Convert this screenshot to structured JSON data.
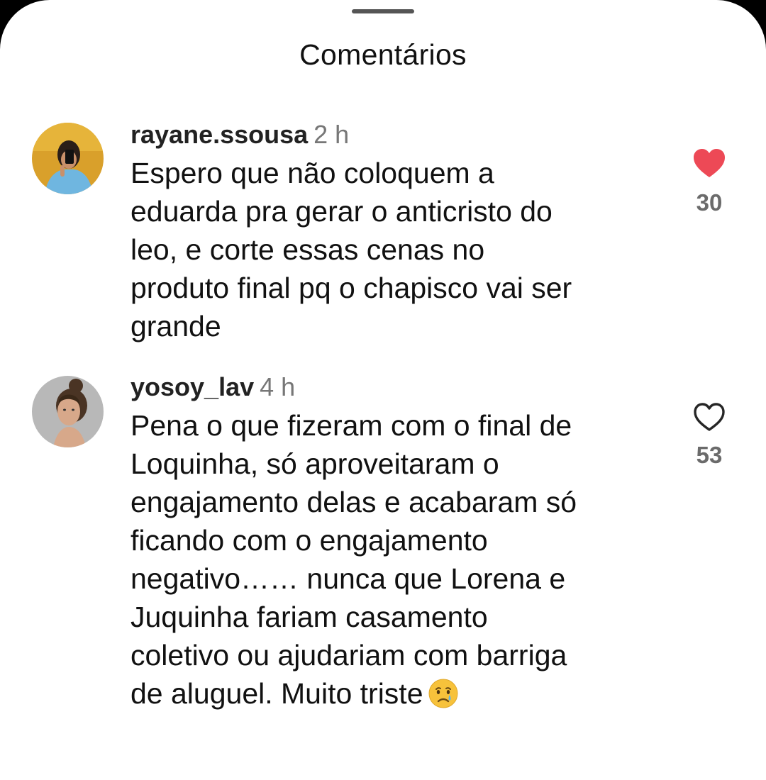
{
  "sheet": {
    "title": "Comentários"
  },
  "comments": [
    {
      "username": "rayane.ssousa",
      "time": "2 h",
      "lines": [
        "Espero que não coloquem a",
        "eduarda pra gerar o anticristo do",
        "leo, e corte essas cenas no",
        "produto final pq o chapisco vai ser",
        "grande"
      ],
      "likes": "30",
      "liked": true,
      "avatar_icon": "avatar-photo"
    },
    {
      "username": "yosoy_lav",
      "time": "4 h",
      "lines": [
        "Pena o que fizeram com o final de",
        "Loquinha, só aproveitaram o",
        "engajamento delas e acabaram só",
        "ficando com o engajamento",
        "negativo…… nunca que Lorena e",
        "Juquinha fariam casamento",
        "coletivo ou ajudariam com barriga",
        "de aluguel. Muito triste"
      ],
      "likes": "53",
      "liked": false,
      "avatar_icon": "avatar-photo",
      "trailing_emoji": "crying-face-emoji"
    }
  ],
  "colors": {
    "like_active": "#ed4956",
    "like_inactive": "#262626",
    "muted_text": "#777777"
  }
}
